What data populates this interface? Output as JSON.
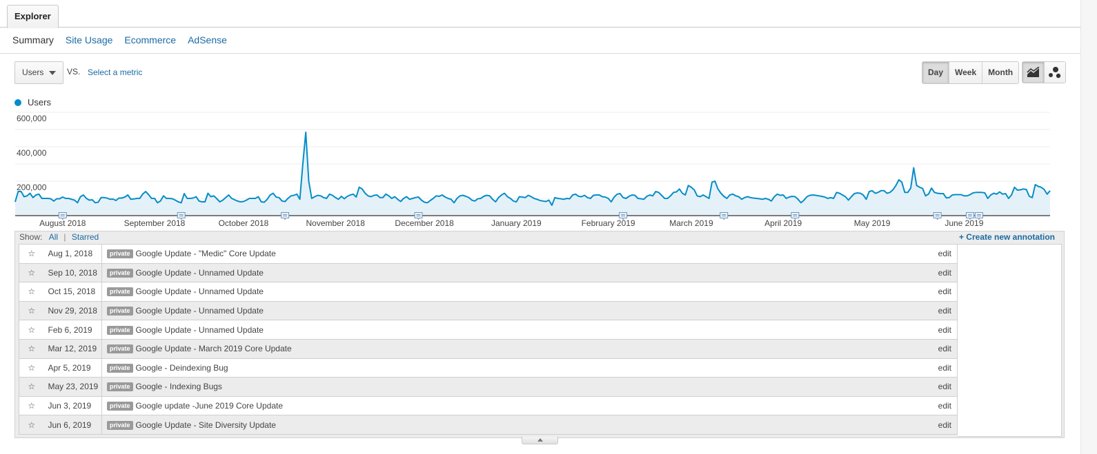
{
  "tabs": {
    "explorer": "Explorer"
  },
  "subnav": {
    "summary": "Summary",
    "site_usage": "Site Usage",
    "ecommerce": "Ecommerce",
    "adsense": "AdSense"
  },
  "controls": {
    "metric": "Users",
    "vs": "VS.",
    "select_metric": "Select a metric",
    "periods": [
      "Day",
      "Week",
      "Month"
    ],
    "active_period": "Day",
    "chart_types": [
      "line-chart-icon",
      "motion-chart-icon"
    ],
    "active_chart_type": "line-chart-icon"
  },
  "colors": {
    "series": "#058dc7",
    "fill": "#e5f1f8",
    "link": "#1a6aa3"
  },
  "chart_data": {
    "type": "area",
    "title": "",
    "legend": [
      "Users"
    ],
    "legend_position": "top-left",
    "series_name": "Users",
    "ylim": [
      0,
      600000
    ],
    "yticks": [
      "600,000",
      "400,000",
      "200,000"
    ],
    "ytick_values": [
      600000,
      400000,
      200000
    ],
    "xlabel": "",
    "ylabel": "",
    "grid": true,
    "x_start": "2018-07-16",
    "x_end": "2019-06-30",
    "month_ticks": [
      {
        "label": "August 2018",
        "date": "2018-08-01"
      },
      {
        "label": "September 2018",
        "date": "2018-09-01"
      },
      {
        "label": "October 2018",
        "date": "2018-10-01"
      },
      {
        "label": "November 2018",
        "date": "2018-11-01"
      },
      {
        "label": "December 2018",
        "date": "2018-12-01"
      },
      {
        "label": "January 2019",
        "date": "2019-01-01"
      },
      {
        "label": "February 2019",
        "date": "2019-02-01"
      },
      {
        "label": "March 2019",
        "date": "2019-03-01"
      },
      {
        "label": "April 2019",
        "date": "2019-04-01"
      },
      {
        "label": "May 2019",
        "date": "2019-05-01"
      },
      {
        "label": "June 2019",
        "date": "2019-06-01"
      }
    ],
    "annotation_dates": [
      "2018-08-01",
      "2018-09-10",
      "2018-10-15",
      "2018-11-29",
      "2019-02-06",
      "2019-03-12",
      "2019-04-05",
      "2019-05-23",
      "2019-06-03",
      "2019-06-06"
    ],
    "baseline": 110000,
    "values": [
      80000,
      140000,
      140000,
      110000,
      115000,
      130000,
      105000,
      120000,
      125000,
      100000,
      100000,
      100000,
      98000,
      85000,
      98000,
      98000,
      108000,
      100000,
      100000,
      95000,
      90000,
      75000,
      110000,
      120000,
      100000,
      90000,
      92000,
      75000,
      78000,
      105000,
      105000,
      102000,
      95000,
      96000,
      88000,
      102000,
      102000,
      108000,
      120000,
      95000,
      97000,
      100000,
      100000,
      125000,
      140000,
      122000,
      100000,
      100000,
      75000,
      85000,
      115000,
      100000,
      100000,
      98000,
      90000,
      80000,
      75000,
      128000,
      100000,
      100000,
      102000,
      110000,
      85000,
      80000,
      80000,
      130000,
      110000,
      115000,
      98000,
      80000,
      90000,
      105000,
      120000,
      100000,
      92000,
      85000,
      80000,
      82000,
      90000,
      100000,
      100000,
      100000,
      110000,
      80000,
      78000,
      95000,
      120000,
      130000,
      108000,
      105000,
      85000,
      82000,
      100000,
      115000,
      118000,
      125000,
      95000,
      300000,
      484000,
      200000,
      100000,
      110000,
      118000,
      115000,
      105000,
      100000,
      125000,
      118000,
      105000,
      95000,
      112000,
      98000,
      112000,
      120000,
      125000,
      108000,
      165000,
      155000,
      130000,
      115000,
      110000,
      118000,
      120000,
      105000,
      105000,
      125000,
      115000,
      100000,
      110000,
      95000,
      82000,
      100000,
      110000,
      95000,
      100000,
      105000,
      108000,
      90000,
      78000,
      75000,
      88000,
      100000,
      115000,
      112000,
      120000,
      108000,
      100000,
      95000,
      75000,
      100000,
      115000,
      118000,
      112000,
      105000,
      90000,
      85000,
      98000,
      100000,
      112000,
      118000,
      115000,
      95000,
      80000,
      105000,
      120000,
      130000,
      110000,
      100000,
      85000,
      80000,
      110000,
      108000,
      105000,
      118000,
      110000,
      100000,
      95000,
      88000,
      85000,
      82000,
      90000,
      60000,
      105000,
      100000,
      98000,
      95000,
      100000,
      98000,
      120000,
      125000,
      112000,
      110000,
      118000,
      105000,
      100000,
      118000,
      120000,
      120000,
      110000,
      108000,
      100000,
      80000,
      108000,
      125000,
      128000,
      105000,
      100000,
      112000,
      120000,
      118000,
      100000,
      98000,
      95000,
      112000,
      120000,
      115000,
      140000,
      135000,
      118000,
      100000,
      100000,
      115000,
      135000,
      138000,
      155000,
      130000,
      120000,
      175000,
      165000,
      150000,
      115000,
      110000,
      120000,
      110000,
      100000,
      195000,
      200000,
      155000,
      130000,
      112000,
      100000,
      120000,
      125000,
      115000,
      110000,
      95000,
      105000,
      110000,
      105000,
      102000,
      100000,
      98000,
      95000,
      100000,
      95000,
      85000,
      110000,
      125000,
      118000,
      120000,
      100000,
      108000,
      112000,
      110000,
      95000,
      75000,
      90000,
      110000,
      118000,
      120000,
      118000,
      115000,
      112000,
      108000,
      100000,
      105000,
      100000,
      135000,
      130000,
      120000,
      110000,
      90000,
      110000,
      128000,
      132000,
      130000,
      120000,
      95000,
      140000,
      145000,
      130000,
      135000,
      145000,
      145000,
      130000,
      135000,
      150000,
      175000,
      208000,
      195000,
      135000,
      135000,
      160000,
      278000,
      175000,
      165000,
      158000,
      115000,
      125000,
      160000,
      135000,
      130000,
      128000,
      128000,
      103000,
      105000,
      120000,
      122000,
      122000,
      122000,
      115000,
      115000,
      122000,
      132000,
      135000,
      135000,
      135000,
      132000,
      100000,
      120000,
      130000,
      125000,
      138000,
      125000,
      128000,
      100000,
      120000,
      165000,
      148000,
      150000,
      155000,
      152000,
      112000,
      105000,
      180000,
      170000,
      165000,
      152000,
      125000,
      145000
    ]
  },
  "annotations_panel": {
    "show_label": "Show:",
    "filter_all": "All",
    "filter_sep": "|",
    "filter_starred": "Starred",
    "create_label": "+ Create new annotation",
    "badge_label": "private",
    "edit_label": "edit",
    "rows": [
      {
        "date": "Aug 1, 2018",
        "text": "Google Update - \"Medic\" Core Update"
      },
      {
        "date": "Sep 10, 2018",
        "text": "Google Update - Unnamed Update"
      },
      {
        "date": "Oct 15, 2018",
        "text": "Google Update - Unnamed Update"
      },
      {
        "date": "Nov 29, 2018",
        "text": "Google Update - Unnamed Update"
      },
      {
        "date": "Feb 6, 2019",
        "text": "Google Update - Unnamed Update"
      },
      {
        "date": "Mar 12, 2019",
        "text": "Google Update - March 2019 Core Update"
      },
      {
        "date": "Apr 5, 2019",
        "text": "Google - Deindexing Bug"
      },
      {
        "date": "May 23, 2019",
        "text": "Google - Indexing Bugs"
      },
      {
        "date": "Jun 3, 2019",
        "text": "Google update -June 2019 Core Update"
      },
      {
        "date": "Jun 6, 2019",
        "text": "Google Update - Site Diversity Update"
      }
    ]
  }
}
